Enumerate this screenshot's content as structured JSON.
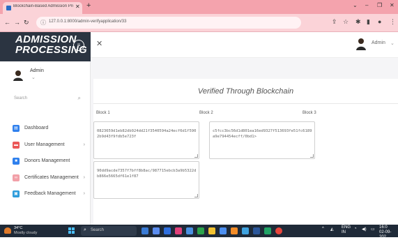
{
  "browser": {
    "tab_title": "Blockchain-Based Admission Pro",
    "tab_close": "✕",
    "new_tab": "+",
    "url": "127.0.0.1:8000/admin-verifyapplication/33",
    "window_controls": [
      "⌄",
      "–",
      "❐",
      "✕"
    ]
  },
  "sidebar": {
    "brand_line1": "ADMISSION",
    "brand_line2": "PROCESSING",
    "toggle_glyph": "≡",
    "user_name": "Admin",
    "user_chevron": "⌄",
    "search_placeholder": "Search",
    "menu": [
      {
        "label": "Dashboard",
        "icon": "dashboard-icon",
        "color": "#2f80ed",
        "arrow": ""
      },
      {
        "label": "User Management",
        "icon": "user-icon",
        "color": "#eb5757",
        "arrow": "›"
      },
      {
        "label": "Donors Management",
        "icon": "donor-icon",
        "color": "#2f80ed",
        "arrow": ""
      },
      {
        "label": "Certificates Management",
        "icon": "certificate-icon",
        "color": "#f2a0a8",
        "arrow": "›"
      },
      {
        "label": "Feedback Management",
        "icon": "feedback-icon",
        "color": "#2d9cdb",
        "arrow": "›"
      }
    ]
  },
  "topbar": {
    "close_glyph": "✕",
    "admin_name": "Admin",
    "admin_chevron": "⌄"
  },
  "card": {
    "title": "Verified Through Blockchain",
    "columns": [
      "Block 1",
      "Block 2",
      "Block 3"
    ],
    "blocks": [
      {
        "hash": "0823659d1eb82db924dd21f3540594a24ecf6d1f5902b9d43f9fdb5e723f"
      },
      {
        "hash": "c5fcc3bc56d1d801ea16ed9327f513693fe51fc6189a9e794454ecff/0bd1>"
      },
      {
        "hash": "90dd9acde7357f7bff8b8ac/987715ebcb3a9b5322db866e5665df61e1f87"
      }
    ]
  },
  "taskbar": {
    "temp": "34°C",
    "weather": "Mostly cloudy",
    "search_label": "Search",
    "lang": "ENG",
    "region": "IN",
    "clock_time": "16:0",
    "clock_date": "02-09-202"
  }
}
